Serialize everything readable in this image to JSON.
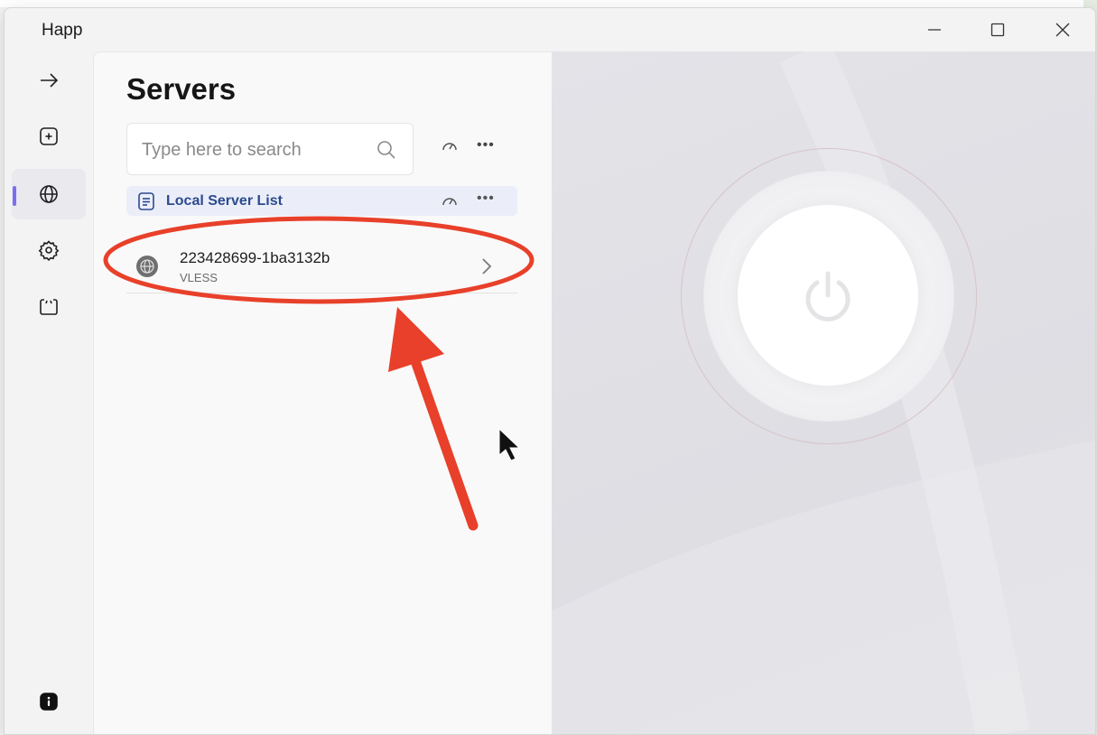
{
  "window": {
    "title": "Happ"
  },
  "rail": {
    "items": [
      "connect",
      "add",
      "servers",
      "settings",
      "logs",
      "info"
    ]
  },
  "panel": {
    "title": "Servers",
    "search": {
      "placeholder": "Type here to search",
      "value": ""
    },
    "group": {
      "label": "Local Server List"
    },
    "servers": [
      {
        "name": "223428699-1ba3132b",
        "protocol": "VLESS"
      }
    ]
  },
  "colors": {
    "accent": "#7c6ef0",
    "group_label": "#2c4a8f",
    "annotation": "#e8402a"
  }
}
